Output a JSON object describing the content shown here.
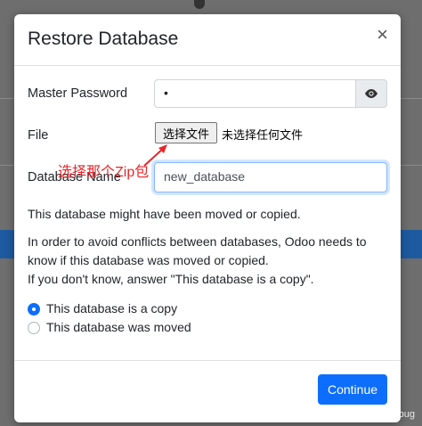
{
  "modal": {
    "title": "Restore Database",
    "close_label": "×"
  },
  "form": {
    "master_password_label": "Master Password",
    "master_password_value": "•",
    "file_label": "File",
    "file_button": "选择文件",
    "file_status": "未选择任何文件",
    "database_name_label": "Database Name",
    "database_name_value": "new_database"
  },
  "annotation": {
    "text": "选择那个Zip包",
    "color": "#e8262b"
  },
  "info": {
    "line1": "This database might have been moved or copied.",
    "line2": "In order to avoid conflicts between databases, Odoo needs to know if this database was moved or copied.",
    "line3": "If you don't know, answer \"This database is a copy\"."
  },
  "options": [
    {
      "label": "This database is a copy",
      "checked": true
    },
    {
      "label": "This database was moved",
      "checked": false
    }
  ],
  "footer": {
    "continue_label": "Continue"
  },
  "watermark": "CSDN @代码总是有bug",
  "colors": {
    "primary": "#0d6efd",
    "annotation": "#e8262b"
  }
}
